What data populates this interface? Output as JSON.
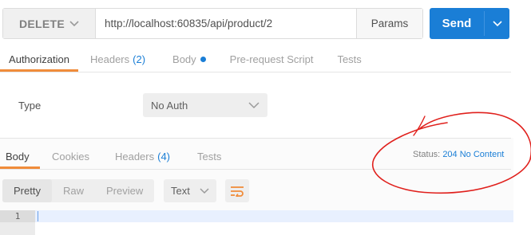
{
  "request": {
    "method": "DELETE",
    "url": "http://localhost:60835/api/product/2",
    "params_label": "Params",
    "send_label": "Send"
  },
  "request_tabs": [
    {
      "label": "Authorization",
      "count": "",
      "active": true
    },
    {
      "label": "Headers",
      "count": "(2)",
      "active": false
    },
    {
      "label": "Body",
      "count": "",
      "active": false,
      "dot": true
    },
    {
      "label": "Pre-request Script",
      "count": "",
      "active": false
    },
    {
      "label": "Tests",
      "count": "",
      "active": false
    }
  ],
  "auth": {
    "type_label": "Type",
    "selected": "No Auth"
  },
  "response_tabs": [
    {
      "label": "Body",
      "count": "",
      "active": true
    },
    {
      "label": "Cookies",
      "count": "",
      "active": false
    },
    {
      "label": "Headers",
      "count": "(4)",
      "active": false
    },
    {
      "label": "Tests",
      "count": "",
      "active": false
    }
  ],
  "status": {
    "label": "Status:",
    "value": "204 No Content"
  },
  "view_modes": [
    "Pretty",
    "Raw",
    "Preview"
  ],
  "active_view": "Pretty",
  "format": "Text",
  "editor": {
    "line_number": "1"
  },
  "colors": {
    "accent": "#1a7ed6",
    "active_tab_underline": "#f08c3a",
    "annotation": "#e0201c"
  },
  "icons": {
    "method_dropdown": "chevron-down-icon",
    "send_dropdown": "chevron-down-icon",
    "auth_dropdown": "chevron-down-icon",
    "format_dropdown": "chevron-down-icon",
    "wrap": "wrap-lines-icon"
  }
}
